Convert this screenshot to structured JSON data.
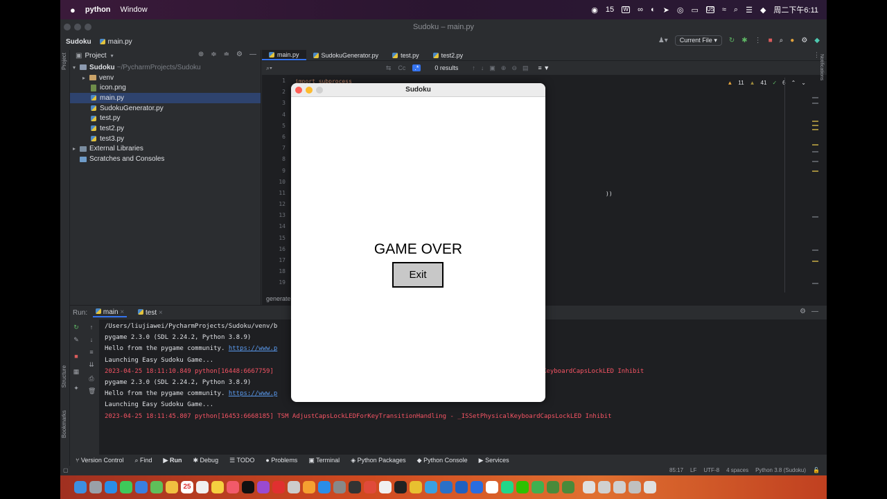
{
  "menubar": {
    "app": "python",
    "window": "Window",
    "badge_count": "15",
    "input_method": "US",
    "datetime": "周二下午6:11"
  },
  "ide": {
    "title": "Sudoku – main.py",
    "project": "Sudoku",
    "file": "main.py",
    "run_config": "Current File"
  },
  "project_panel": {
    "header": "Project",
    "root": "Sudoku",
    "root_path": "~/PycharmProjects/Sudoku",
    "items": [
      "venv",
      "icon.png",
      "main.py",
      "SudokuGenerator.py",
      "test.py",
      "test2.py",
      "test3.py"
    ],
    "external": "External Libraries",
    "scratches": "Scratches and Consoles"
  },
  "editor": {
    "tabs": [
      "main.py",
      "SudokuGenerator.py",
      "test.py",
      "test2.py"
    ],
    "search_results": "0 results",
    "line_numbers": [
      "1",
      "2",
      "3",
      "4",
      "5",
      "6",
      "7",
      "8",
      "9",
      "10",
      "11",
      "12",
      "13",
      "14",
      "15",
      "16",
      "17",
      "18",
      "19"
    ],
    "warnings": "11",
    "weak_warnings": "41",
    "typos": "6",
    "code_fragment": "import subprocess",
    "code_tail": "))",
    "breadcrumb": "generate"
  },
  "run_panel": {
    "label": "Run:",
    "tabs": [
      "main",
      "test"
    ],
    "lines": [
      {
        "text": "/Users/liujiawei/PycharmProjects/Sudoku/venv/b",
        "kind": "normal"
      },
      {
        "text": "pygame 2.3.0 (SDL 2.24.2, Python 3.8.9)",
        "kind": "normal"
      },
      {
        "text": "Hello from the pygame community. ",
        "link": "https://www.p",
        "kind": "link"
      },
      {
        "text": "Launching Easy Sudoku Game...",
        "kind": "normal"
      },
      {
        "text": "2023-04-25 18:11:10.849 python[16448:6667759]",
        "tail": "KeyboardCapsLockLED Inhibit",
        "kind": "err"
      },
      {
        "text": "pygame 2.3.0 (SDL 2.24.2, Python 3.8.9)",
        "kind": "normal"
      },
      {
        "text": "Hello from the pygame community. ",
        "link": "https://www.p",
        "kind": "link"
      },
      {
        "text": "Launching Easy Sudoku Game...",
        "kind": "normal"
      },
      {
        "text": "2023-04-25 18:11:45.807 python[16453:6668185] TSM AdjustCapsLockLEDForKeyTransitionHandling - _ISSetPhysicalKeyboardCapsLockLED Inhibit",
        "kind": "err"
      }
    ]
  },
  "bottom_tools": [
    "Version Control",
    "Find",
    "Run",
    "Debug",
    "TODO",
    "Problems",
    "Terminal",
    "Python Packages",
    "Python Console",
    "Services"
  ],
  "statusbar": {
    "position": "85:17",
    "line_sep": "LF",
    "encoding": "UTF-8",
    "indent": "4 spaces",
    "interpreter": "Python 3.8 (Sudoku)"
  },
  "side_labels": {
    "project": "Project",
    "structure": "Structure",
    "bookmarks": "Bookmarks",
    "notifications": "Notifications"
  },
  "sudoku_window": {
    "title": "Sudoku",
    "message": "GAME OVER",
    "exit_label": "Exit"
  },
  "dock": {
    "calendar_day": "25"
  },
  "colors": {
    "ide_bg": "#2b2d30",
    "editor_bg": "#1e1f22",
    "selection": "#2e436e",
    "error_text": "#f75464",
    "link": "#5a9bf0",
    "accent": "#3574f0"
  }
}
